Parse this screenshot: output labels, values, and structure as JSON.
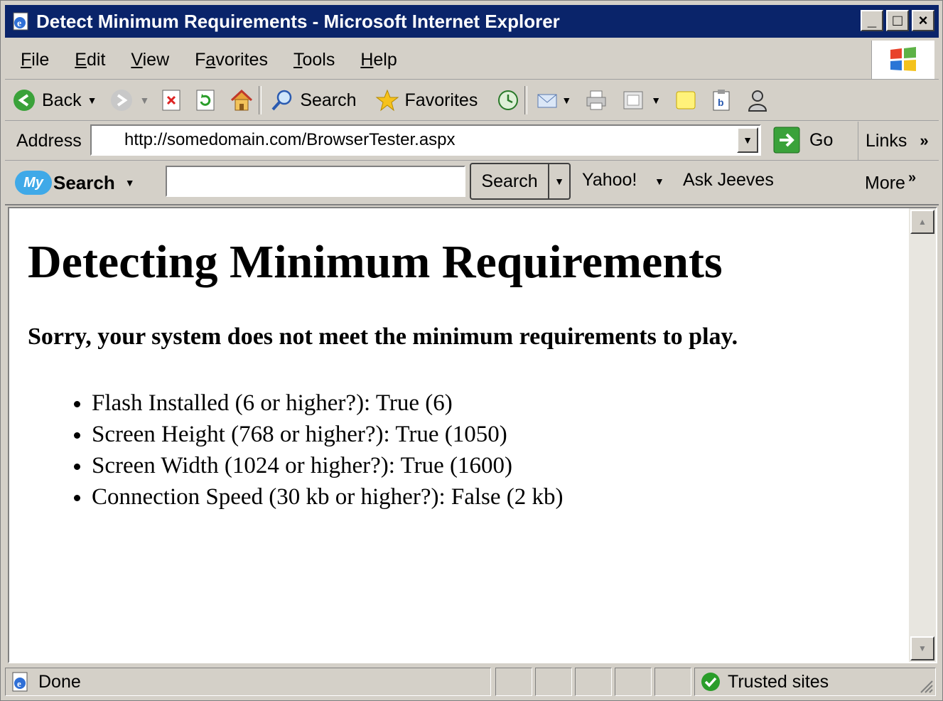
{
  "window": {
    "title": "Detect Minimum Requirements - Microsoft Internet Explorer",
    "buttons": {
      "minimize": "_",
      "maximize": "□",
      "close": "×"
    }
  },
  "menu": {
    "items": [
      {
        "pre": "",
        "key": "F",
        "post": "ile"
      },
      {
        "pre": "",
        "key": "E",
        "post": "dit"
      },
      {
        "pre": "",
        "key": "V",
        "post": "iew"
      },
      {
        "pre": "F",
        "key": "a",
        "post": "vorites"
      },
      {
        "pre": "",
        "key": "T",
        "post": "ools"
      },
      {
        "pre": "",
        "key": "H",
        "post": "elp"
      }
    ]
  },
  "toolbar": {
    "back_label": "Back",
    "search_label": "Search",
    "favorites_label": "Favorites"
  },
  "address": {
    "label": "Address",
    "url": "http://somedomain.com/BrowserTester.aspx",
    "go_label": "Go",
    "links_label": "Links",
    "links_chevron": "»"
  },
  "mysearch": {
    "badge": "My",
    "title": "Search",
    "input_value": "",
    "button_label": "Search",
    "yahoo_label": "Yahoo!",
    "jeeves_label": "Ask Jeeves",
    "more_label": "More",
    "more_chevron": "»"
  },
  "page": {
    "heading": "Detecting Minimum Requirements",
    "message": "Sorry, your system does not meet the minimum requirements to play.",
    "requirements": [
      "Flash Installed (6 or higher?): True (6)",
      "Screen Height (768 or higher?): True (1050)",
      "Screen Width (1024 or higher?): True (1600)",
      "Connection Speed (30 kb or higher?): False (2 kb)"
    ]
  },
  "status": {
    "text": "Done",
    "zone": "Trusted sites"
  },
  "colors": {
    "titlebar": "#0a246a",
    "chrome": "#d4d0c8",
    "content_bg": "#ffffff",
    "trusted_green": "#2a9d2a"
  }
}
